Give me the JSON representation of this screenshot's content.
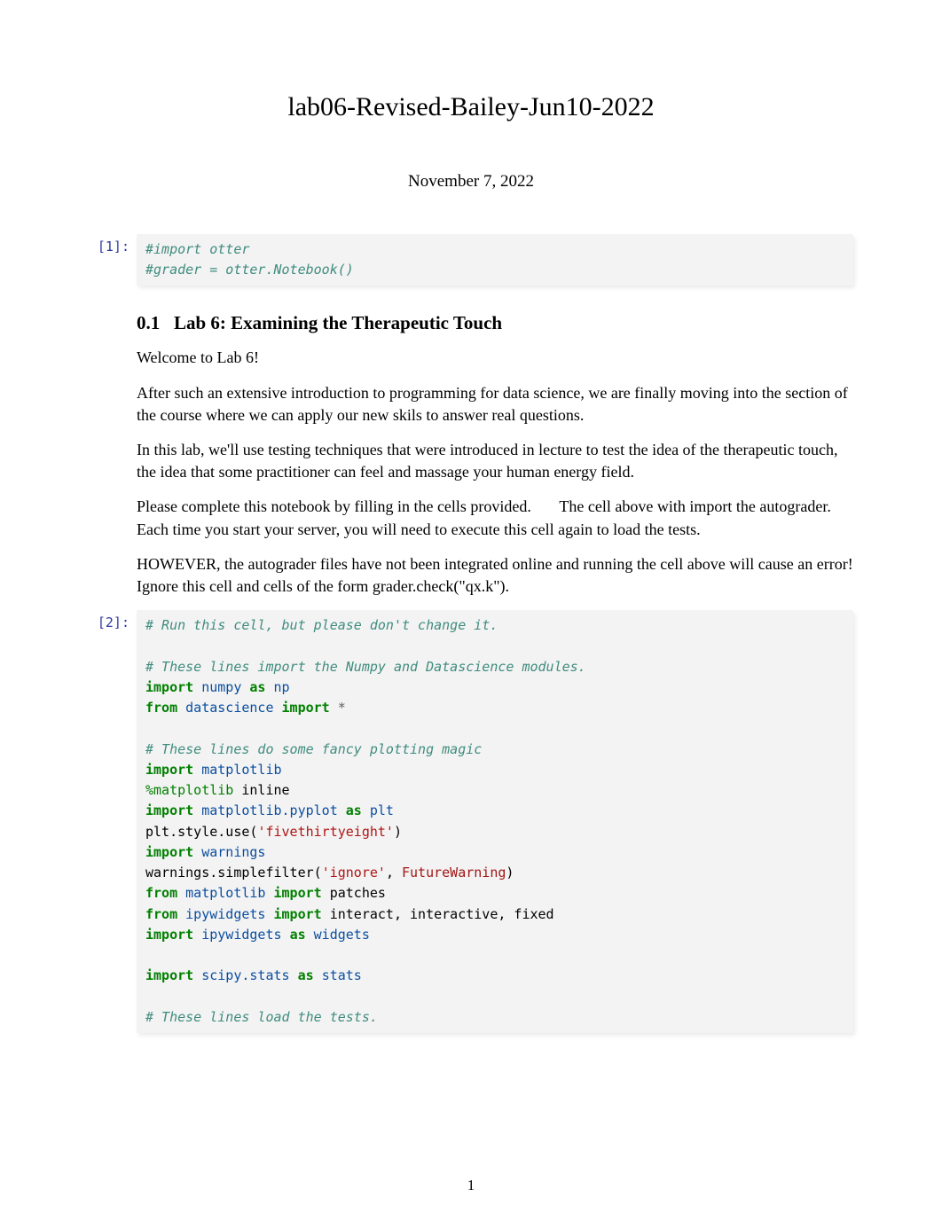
{
  "title": "lab06-Revised-Bailey-Jun10-2022",
  "date": "November 7, 2022",
  "cell1": {
    "prompt": "[1]:",
    "line1": "#import otter",
    "line2": "#grader = otter.Notebook()"
  },
  "md": {
    "section_num": "0.1",
    "section_title": "Lab 6: Examining the Therapeutic Touch",
    "p1": "Welcome to Lab 6!",
    "p2": "After such an extensive introduction to programming for data science, we are finally moving into the section of the course where we can apply our new skils to answer real questions.",
    "p3": "In this lab, we'll use testing techniques that were introduced in lecture to test the idea of the therapeutic touch, the idea that some practitioner can feel and massage your human energy field.",
    "p4a": "Please complete this notebook by filling in the cells provided.",
    "p4b": "The cell above with import the autograder. Each time you start your server, you will need to execute this cell again to load the tests.",
    "p5": "HOWEVER, the autograder files have not been integrated online and running the cell above will cause an error! Ignore this cell and cells of the form grader.check(\"qx.k\")."
  },
  "cell2": {
    "prompt": "[2]:",
    "c1": "# Run this cell, but please don't change it.",
    "c2": "# These lines import the Numpy and Datascience modules.",
    "kw_import": "import",
    "kw_as": "as",
    "kw_from": "from",
    "mod_numpy": "numpy",
    "alias_np": "np",
    "mod_datascience": "datascience",
    "star": "*",
    "c3": "# These lines do some fancy plotting magic",
    "mod_matplotlib": "matplotlib",
    "magic": "%matplotlib",
    "magic_arg": "inline",
    "mod_pyplot": "matplotlib.pyplot",
    "alias_plt": "plt",
    "plt_style": "plt.style.use(",
    "str_style": "'fivethirtyeight'",
    "close_paren": ")",
    "mod_warnings": "warnings",
    "warn_call": "warnings.simplefilter(",
    "str_ignore": "'ignore'",
    "comma": ", ",
    "name_fw": "FutureWarning",
    "mod_patches": "patches",
    "mod_ipyw": "ipywidgets",
    "ipyw_names": "interact, interactive, fixed",
    "alias_widgets": "widgets",
    "mod_scipy": "scipy.stats",
    "alias_stats": "stats",
    "c4": "# These lines load the tests."
  },
  "page_number": "1"
}
